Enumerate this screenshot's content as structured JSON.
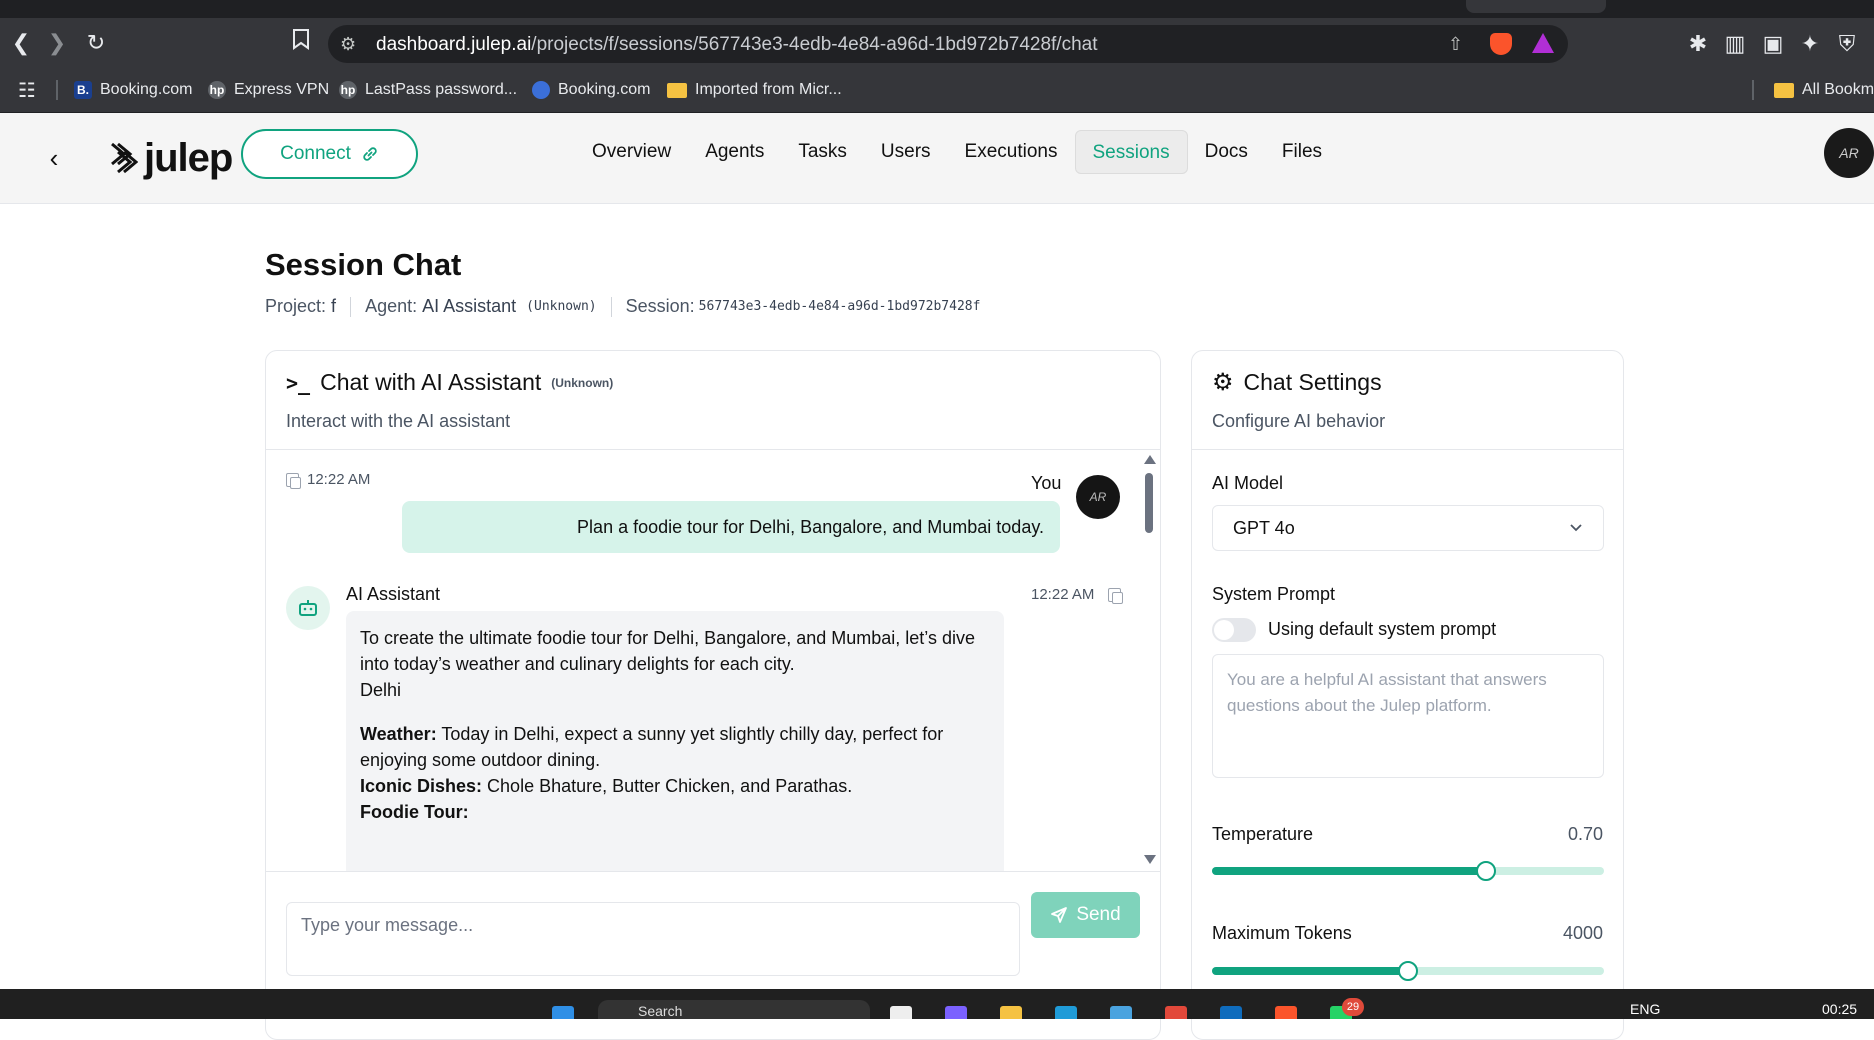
{
  "browser": {
    "url_host": "dashboard.julep.ai",
    "url_path": "/projects/f/sessions/567743e3-4edb-4e84-a96d-1bd972b7428f/chat",
    "bookmarks": [
      {
        "label": "Booking.com",
        "icon": "B."
      },
      {
        "label": "Express VPN"
      },
      {
        "label": "LastPass password..."
      },
      {
        "label": "Booking.com"
      },
      {
        "label": "Imported from Micr..."
      }
    ],
    "all_bookmarks_label": "All Bookma"
  },
  "header": {
    "logo_text": "julep",
    "connect_label": "Connect",
    "nav": [
      "Overview",
      "Agents",
      "Tasks",
      "Users",
      "Executions",
      "Sessions",
      "Docs",
      "Files"
    ],
    "active_nav": "Sessions",
    "avatar_initials": "AR"
  },
  "page": {
    "title": "Session Chat",
    "project_label": "Project:",
    "project_value": "f",
    "agent_label": "Agent:",
    "agent_value": "AI Assistant",
    "agent_status": "(Unknown)",
    "session_label": "Session:",
    "session_value": "567743e3-4edb-4e84-a96d-1bd972b7428f"
  },
  "chat": {
    "title": "Chat with AI Assistant",
    "status": "(Unknown)",
    "subtitle": "Interact with the AI assistant",
    "user_msg": {
      "time": "12:22 AM",
      "sender": "You",
      "avatar_initials": "AR",
      "text": "Plan a foodie tour for Delhi, Bangalore, and Mumbai today."
    },
    "bot_msg": {
      "sender": "AI Assistant",
      "time": "12:22 AM",
      "intro": "To create the ultimate foodie tour for Delhi, Bangalore, and Mumbai, let’s dive into today’s weather and culinary delights for each city.",
      "city": "Delhi",
      "weather_label": "Weather:",
      "weather_text": " Today in Delhi, expect a sunny yet slightly chilly day, perfect for enjoying some outdoor dining.",
      "dishes_label": "Iconic Dishes:",
      "dishes_text": " Chole Bhature, Butter Chicken, and Parathas.",
      "tour_label": "Foodie Tour:"
    },
    "input_placeholder": "Type your message...",
    "send_label": "Send"
  },
  "settings": {
    "title": "Chat Settings",
    "subtitle": "Configure AI behavior",
    "model_label": "AI Model",
    "model_value": "GPT 4o",
    "prompt_label": "System Prompt",
    "toggle_label": "Using default system prompt",
    "prompt_placeholder": "You are a helpful AI assistant that answers questions about the Julep platform.",
    "temperature_label": "Temperature",
    "temperature_value": "0.70",
    "temperature_fraction": 0.7,
    "max_tokens_label": "Maximum Tokens",
    "max_tokens_value": "4000",
    "max_tokens_fraction": 0.5
  },
  "taskbar": {
    "search_label": "Search",
    "lang": "ENG",
    "clock": "00:25",
    "badge_count": "29"
  }
}
